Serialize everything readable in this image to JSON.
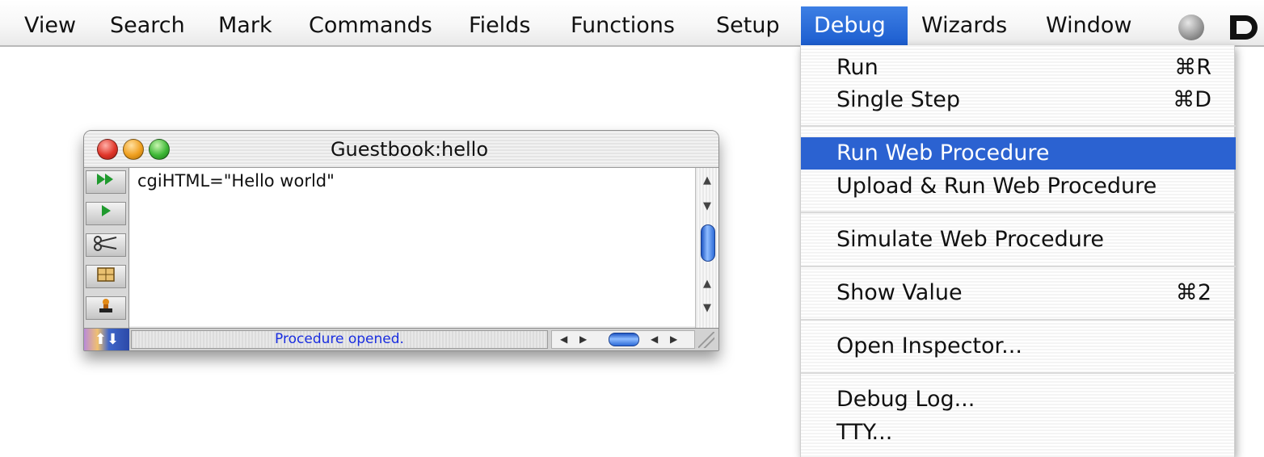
{
  "menubar": {
    "items": [
      "View",
      "Search",
      "Mark",
      "Commands",
      "Fields",
      "Functions",
      "Setup",
      "Debug",
      "Wizards",
      "Window"
    ],
    "active": "Debug"
  },
  "debug_menu": {
    "items": [
      {
        "label": "Run",
        "shortcut": "⌘R"
      },
      {
        "label": "Single Step",
        "shortcut": "⌘D"
      },
      {
        "label": "Run Web Procedure",
        "shortcut": "",
        "highlighted": true
      },
      {
        "label": "Upload & Run Web Procedure",
        "shortcut": ""
      },
      {
        "label": "Simulate Web Procedure",
        "shortcut": ""
      },
      {
        "label": "Show Value",
        "shortcut": "⌘2"
      },
      {
        "label": "Open Inspector...",
        "shortcut": ""
      },
      {
        "label": "Debug Log...",
        "shortcut": ""
      },
      {
        "label": "TTY...",
        "shortcut": ""
      }
    ]
  },
  "procedure_window": {
    "title": "Guestbook:hello",
    "code": "cgiHTML=\"Hello world\"",
    "status": "Procedure opened.",
    "tools": [
      "fast-forward-icon",
      "play-icon",
      "scissors-icon",
      "grid-icon",
      "stamp-icon"
    ]
  },
  "colors": {
    "accent": "#2b62d1",
    "status_text": "#1a2ee0"
  }
}
